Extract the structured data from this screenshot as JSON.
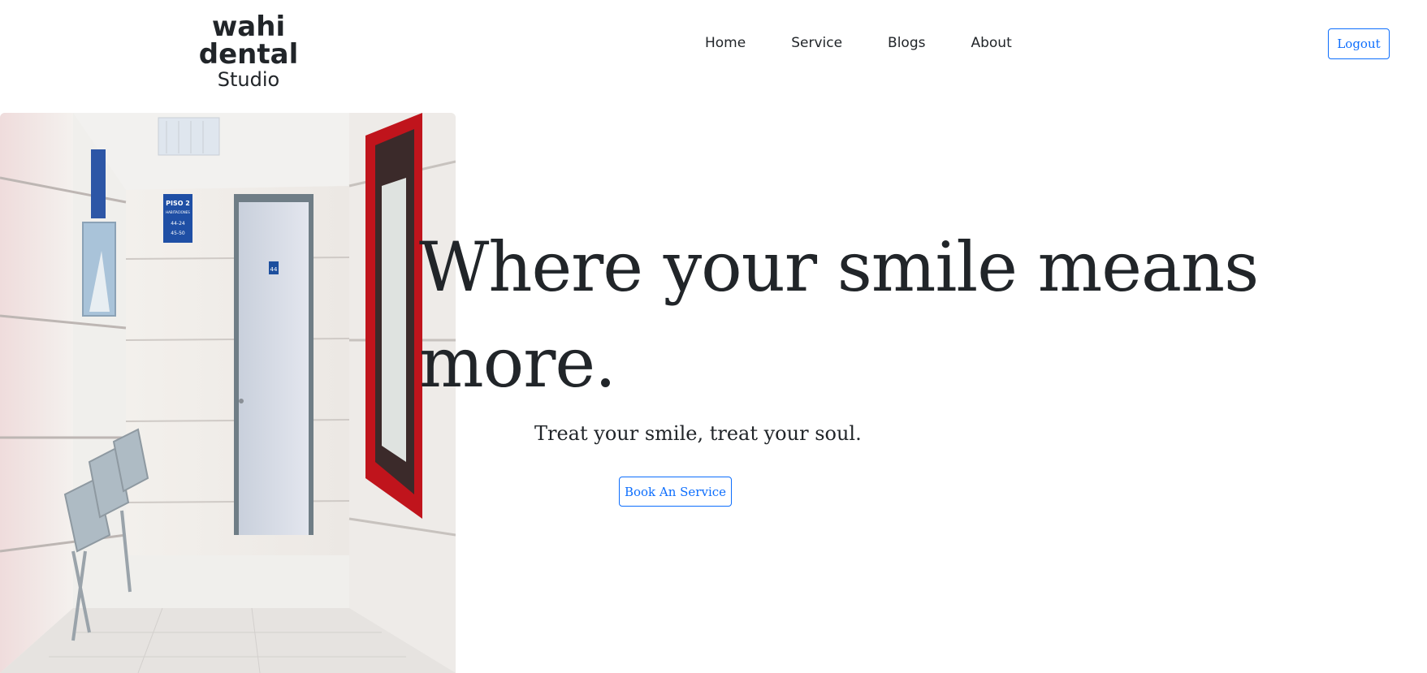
{
  "brand": {
    "name": "wahi dental",
    "sub": "Studio"
  },
  "nav": {
    "items": [
      "Home",
      "Service",
      "Blogs",
      "About"
    ]
  },
  "header": {
    "logout_label": "Logout"
  },
  "hero": {
    "headline": "Where your smile means more.",
    "tagline": "Treat your smile, treat your soul.",
    "cta_label": "Book An Service",
    "image_signs": {
      "floor_sign_title": "PISO 2",
      "floor_sign_sub": "HABITACIONES",
      "room_a": "44-24",
      "room_b": "45-50",
      "door_number": "44"
    }
  },
  "colors": {
    "accent": "#0d6efd",
    "text": "#212529",
    "frame_red": "#c0141c"
  }
}
